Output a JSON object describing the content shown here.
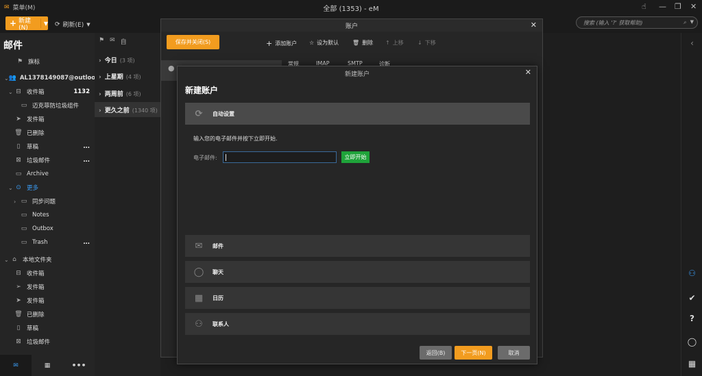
{
  "app": {
    "menu_label": "菜单(M)",
    "window_title": "全部 (1353) - eM"
  },
  "toolbar": {
    "new_label": "新建(N)",
    "refresh_label": "刷新(E)",
    "search_placeholder": "搜索 (输入 '?' 获取帮助)"
  },
  "sidebar": {
    "heading": "邮件",
    "flag_label": "旗标",
    "account_label": "AL1378149087@outloo",
    "inbox_label": "收件箱",
    "inbox_count": "1132",
    "folders": [
      {
        "label": "迈克菲防垃圾组件"
      },
      {
        "label": "发件箱"
      },
      {
        "label": "已删除"
      },
      {
        "label": "草稿",
        "dots": "..."
      },
      {
        "label": "垃圾邮件",
        "dots": "..."
      },
      {
        "label": "Archive"
      }
    ],
    "more_label": "更多",
    "more_items": [
      {
        "label": "同步问题"
      },
      {
        "label": "Notes"
      },
      {
        "label": "Outbox"
      },
      {
        "label": "Trash",
        "dots": "..."
      }
    ],
    "local_label": "本地文件夹",
    "local_items": [
      {
        "label": "收件箱"
      },
      {
        "label": "发件箱"
      },
      {
        "label": "发件箱"
      },
      {
        "label": "已删除"
      },
      {
        "label": "草稿"
      },
      {
        "label": "垃圾邮件"
      }
    ]
  },
  "msglist": {
    "header_label": "自",
    "groups": [
      {
        "label": "今日",
        "count": "(3 项)"
      },
      {
        "label": "上星期",
        "count": "(4 项)"
      },
      {
        "label": "两周前",
        "count": "(6 项)"
      },
      {
        "label": "更久之前",
        "count": "(1340 项)"
      }
    ]
  },
  "accounts_dialog": {
    "title": "账户",
    "save_close": "保存并关闭(S)",
    "add_account": "添加账户",
    "set_default": "设为默认",
    "delete": "删除",
    "move_up": "上移",
    "move_down": "下移",
    "tabs": [
      "常规",
      "IMAP",
      "SMTP",
      "诊断"
    ]
  },
  "new_account_dialog": {
    "title": "新建账户",
    "heading": "新建账户",
    "auto_setup": "自动设置",
    "prompt": "输入您的电子邮件并按下立即开始.",
    "email_label": "电子邮件:",
    "email_value": "",
    "start_button": "立即开始",
    "sections": [
      "邮件",
      "聊天",
      "日历",
      "联系人"
    ],
    "back_button": "返回(B)",
    "next_button": "下一页(N)",
    "cancel_button": "取消"
  },
  "colors": {
    "accent_orange": "#f29c1f",
    "start_green": "#1fa33a",
    "link_blue": "#3a9bf3"
  }
}
